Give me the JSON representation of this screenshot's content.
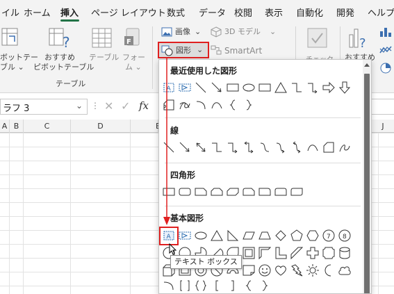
{
  "tabs": [
    {
      "label": "イル",
      "active": false
    },
    {
      "label": "ホーム",
      "active": false
    },
    {
      "label": "挿入",
      "active": true
    },
    {
      "label": "ページ レイアウト",
      "active": false
    },
    {
      "label": "数式",
      "active": false
    },
    {
      "label": "データ",
      "active": false
    },
    {
      "label": "校閲",
      "active": false
    },
    {
      "label": "表示",
      "active": false
    },
    {
      "label": "自動化",
      "active": false
    },
    {
      "label": "開発",
      "active": false
    },
    {
      "label": "ヘルプ",
      "active": false
    }
  ],
  "ribbon": {
    "pivot_partial_line1": "ボットテー",
    "pivot_partial_line2": "ブル ⌄",
    "recommended_pivot_line1": "おすすめ",
    "recommended_pivot_line2": "ピボットテーブル",
    "table_label": "テーブル",
    "form_line1": "フォー",
    "form_line2": "ム ⌄",
    "group_table": "テーブル",
    "image_label": "画像",
    "model3d_label": "3D モデル",
    "shapes_label": "図形",
    "smartart_label": "SmartArt",
    "check_label": "チェック",
    "recommended_chart_label": "おすすめ"
  },
  "formula_bar": {
    "name_box": "ラフ 3",
    "fx": "fx"
  },
  "columns": [
    "A",
    "B",
    "C",
    "D",
    "E",
    "J"
  ],
  "shapes_panel": {
    "sections": [
      {
        "title": "最近使用した図形"
      },
      {
        "title": "線"
      },
      {
        "title": "四角形"
      },
      {
        "title": "基本図形"
      }
    ]
  },
  "tooltip": "テキスト ボックス",
  "colors": {
    "accent": "#217346",
    "highlight": "#e02020",
    "shape_stroke": "#333333",
    "selected_shape": "#2b6cb0"
  }
}
